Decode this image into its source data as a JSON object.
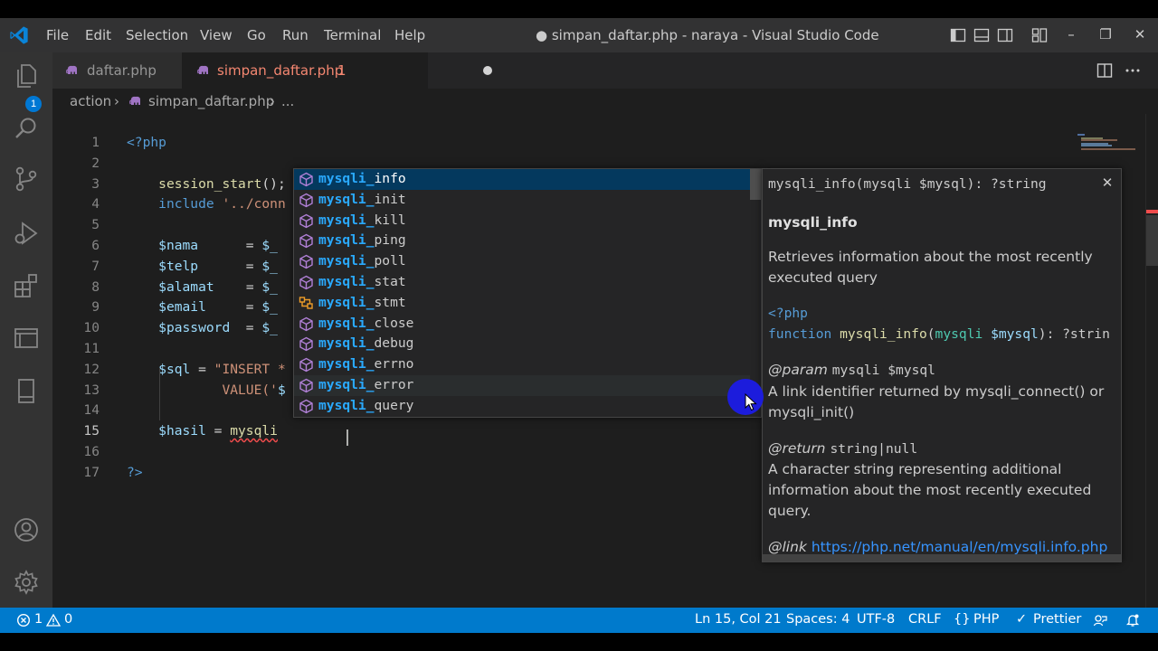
{
  "window": {
    "title": "● simpan_daftar.php - naraya - Visual Studio Code",
    "menu": [
      "File",
      "Edit",
      "Selection",
      "View",
      "Go",
      "Run",
      "Terminal",
      "Help"
    ],
    "controls": {
      "minimize": "–",
      "restore": "❐",
      "close": "✕"
    }
  },
  "activity_bar": {
    "explorer_badge": "1",
    "icons": [
      "explorer-icon",
      "search-icon",
      "source-control-icon",
      "run-debug-icon",
      "extensions-icon",
      "remote-explorer-icon",
      "bookmark-icon",
      "account-icon",
      "settings-gear-icon"
    ]
  },
  "tabs": [
    {
      "label": "daftar.php",
      "active": false
    },
    {
      "label": "simpan_daftar.php",
      "problems": "1",
      "active": true,
      "dirty": true
    }
  ],
  "breadcrumb": {
    "folder": "action",
    "file": "simpan_daftar.php",
    "more": "..."
  },
  "editor": {
    "line_numbers": [
      "1",
      "2",
      "3",
      "4",
      "5",
      "6",
      "7",
      "8",
      "9",
      "10",
      "11",
      "12",
      "13",
      "14",
      "15",
      "16",
      "17"
    ],
    "active_line": "15",
    "lines": [
      [
        {
          "t": "<?php",
          "c": "keyword"
        }
      ],
      [],
      [
        {
          "t": "    "
        },
        {
          "t": "session_start",
          "c": "fn"
        },
        {
          "t": "();"
        }
      ],
      [
        {
          "t": "    "
        },
        {
          "t": "include",
          "c": "keyword"
        },
        {
          "t": " "
        },
        {
          "t": "'../conn",
          "c": "str"
        }
      ],
      [],
      [
        {
          "t": "    "
        },
        {
          "t": "$nama",
          "c": "var"
        },
        {
          "t": "      = "
        },
        {
          "t": "$_",
          "c": "var"
        }
      ],
      [
        {
          "t": "    "
        },
        {
          "t": "$telp",
          "c": "var"
        },
        {
          "t": "      = "
        },
        {
          "t": "$_",
          "c": "var"
        }
      ],
      [
        {
          "t": "    "
        },
        {
          "t": "$alamat",
          "c": "var"
        },
        {
          "t": "    = "
        },
        {
          "t": "$_",
          "c": "var"
        }
      ],
      [
        {
          "t": "    "
        },
        {
          "t": "$email",
          "c": "var"
        },
        {
          "t": "     = "
        },
        {
          "t": "$_",
          "c": "var"
        }
      ],
      [
        {
          "t": "    "
        },
        {
          "t": "$password",
          "c": "var"
        },
        {
          "t": "  = "
        },
        {
          "t": "$_",
          "c": "var"
        }
      ],
      [],
      [
        {
          "t": "    "
        },
        {
          "t": "$sql",
          "c": "var"
        },
        {
          "t": " = "
        },
        {
          "t": "\"INSERT *",
          "c": "str"
        }
      ],
      [
        {
          "t": "            "
        },
        {
          "t": "VALUE('",
          "c": "str"
        },
        {
          "t": "$",
          "c": "var"
        }
      ],
      [],
      [
        {
          "t": "    "
        },
        {
          "t": "$hasil",
          "c": "var"
        },
        {
          "t": " = "
        },
        {
          "t": "mysqli",
          "c": "fn",
          "squiggle": true
        },
        {
          "t": " "
        }
      ],
      [],
      [
        {
          "t": "?>",
          "c": "keyword"
        }
      ]
    ]
  },
  "suggestions": {
    "typed": "mysqli_",
    "items": [
      {
        "prefix": "mysqli_",
        "rest": "info",
        "kind": "method",
        "selected": true
      },
      {
        "prefix": "mysqli_",
        "rest": "init",
        "kind": "method"
      },
      {
        "prefix": "mysqli_",
        "rest": "kill",
        "kind": "method"
      },
      {
        "prefix": "mysqli_",
        "rest": "ping",
        "kind": "method"
      },
      {
        "prefix": "mysqli_",
        "rest": "poll",
        "kind": "method"
      },
      {
        "prefix": "mysqli_",
        "rest": "stat",
        "kind": "method"
      },
      {
        "prefix": "mysqli_",
        "rest": "stmt",
        "kind": "class"
      },
      {
        "prefix": "mysqli_",
        "rest": "close",
        "kind": "method"
      },
      {
        "prefix": "mysqli_",
        "rest": "debug",
        "kind": "method"
      },
      {
        "prefix": "mysqli_",
        "rest": "errno",
        "kind": "method"
      },
      {
        "prefix": "mysqli_",
        "rest": "error",
        "kind": "method",
        "hover": true
      },
      {
        "prefix": "mysqli_",
        "rest": "query",
        "kind": "method"
      }
    ]
  },
  "details": {
    "signature": "mysqli_info(mysqli $mysql): ?string",
    "close": "✕",
    "title": "mysqli_info",
    "description_1": "Retrieves information about the most recently",
    "description_2": "executed query",
    "code_1": "<?php",
    "code_2_kw": "function",
    "code_2_fn": "mysqli_info",
    "code_2_type": "mysqli",
    "code_2_var": "$mysql",
    "code_2_rest": "): ?strin",
    "param_tag": "@param",
    "param_value": "mysqli $mysql",
    "param_desc_1": "A link identifier returned by mysqli_connect() or",
    "param_desc_2": "mysqli_init()",
    "return_tag": "@return",
    "return_value": "string|null",
    "return_desc_1": "A character string representing additional",
    "return_desc_2": "information about the most recently executed",
    "return_desc_3": "query.",
    "link_tag": "@link",
    "link_url": "https://php.net/manual/en/mysqli.info.php"
  },
  "status_bar": {
    "errors": "1",
    "warnings": "0",
    "position": "Ln 15, Col 21",
    "spaces": "Spaces: 4",
    "encoding": "UTF-8",
    "eol": "CRLF",
    "language": "PHP",
    "formatter": "Prettier"
  },
  "colors": {
    "accent": "#007acc",
    "suggestion_match": "#2aaaff",
    "modified_tab": "#f48771",
    "pointer_halo": "#1c1cdc"
  }
}
